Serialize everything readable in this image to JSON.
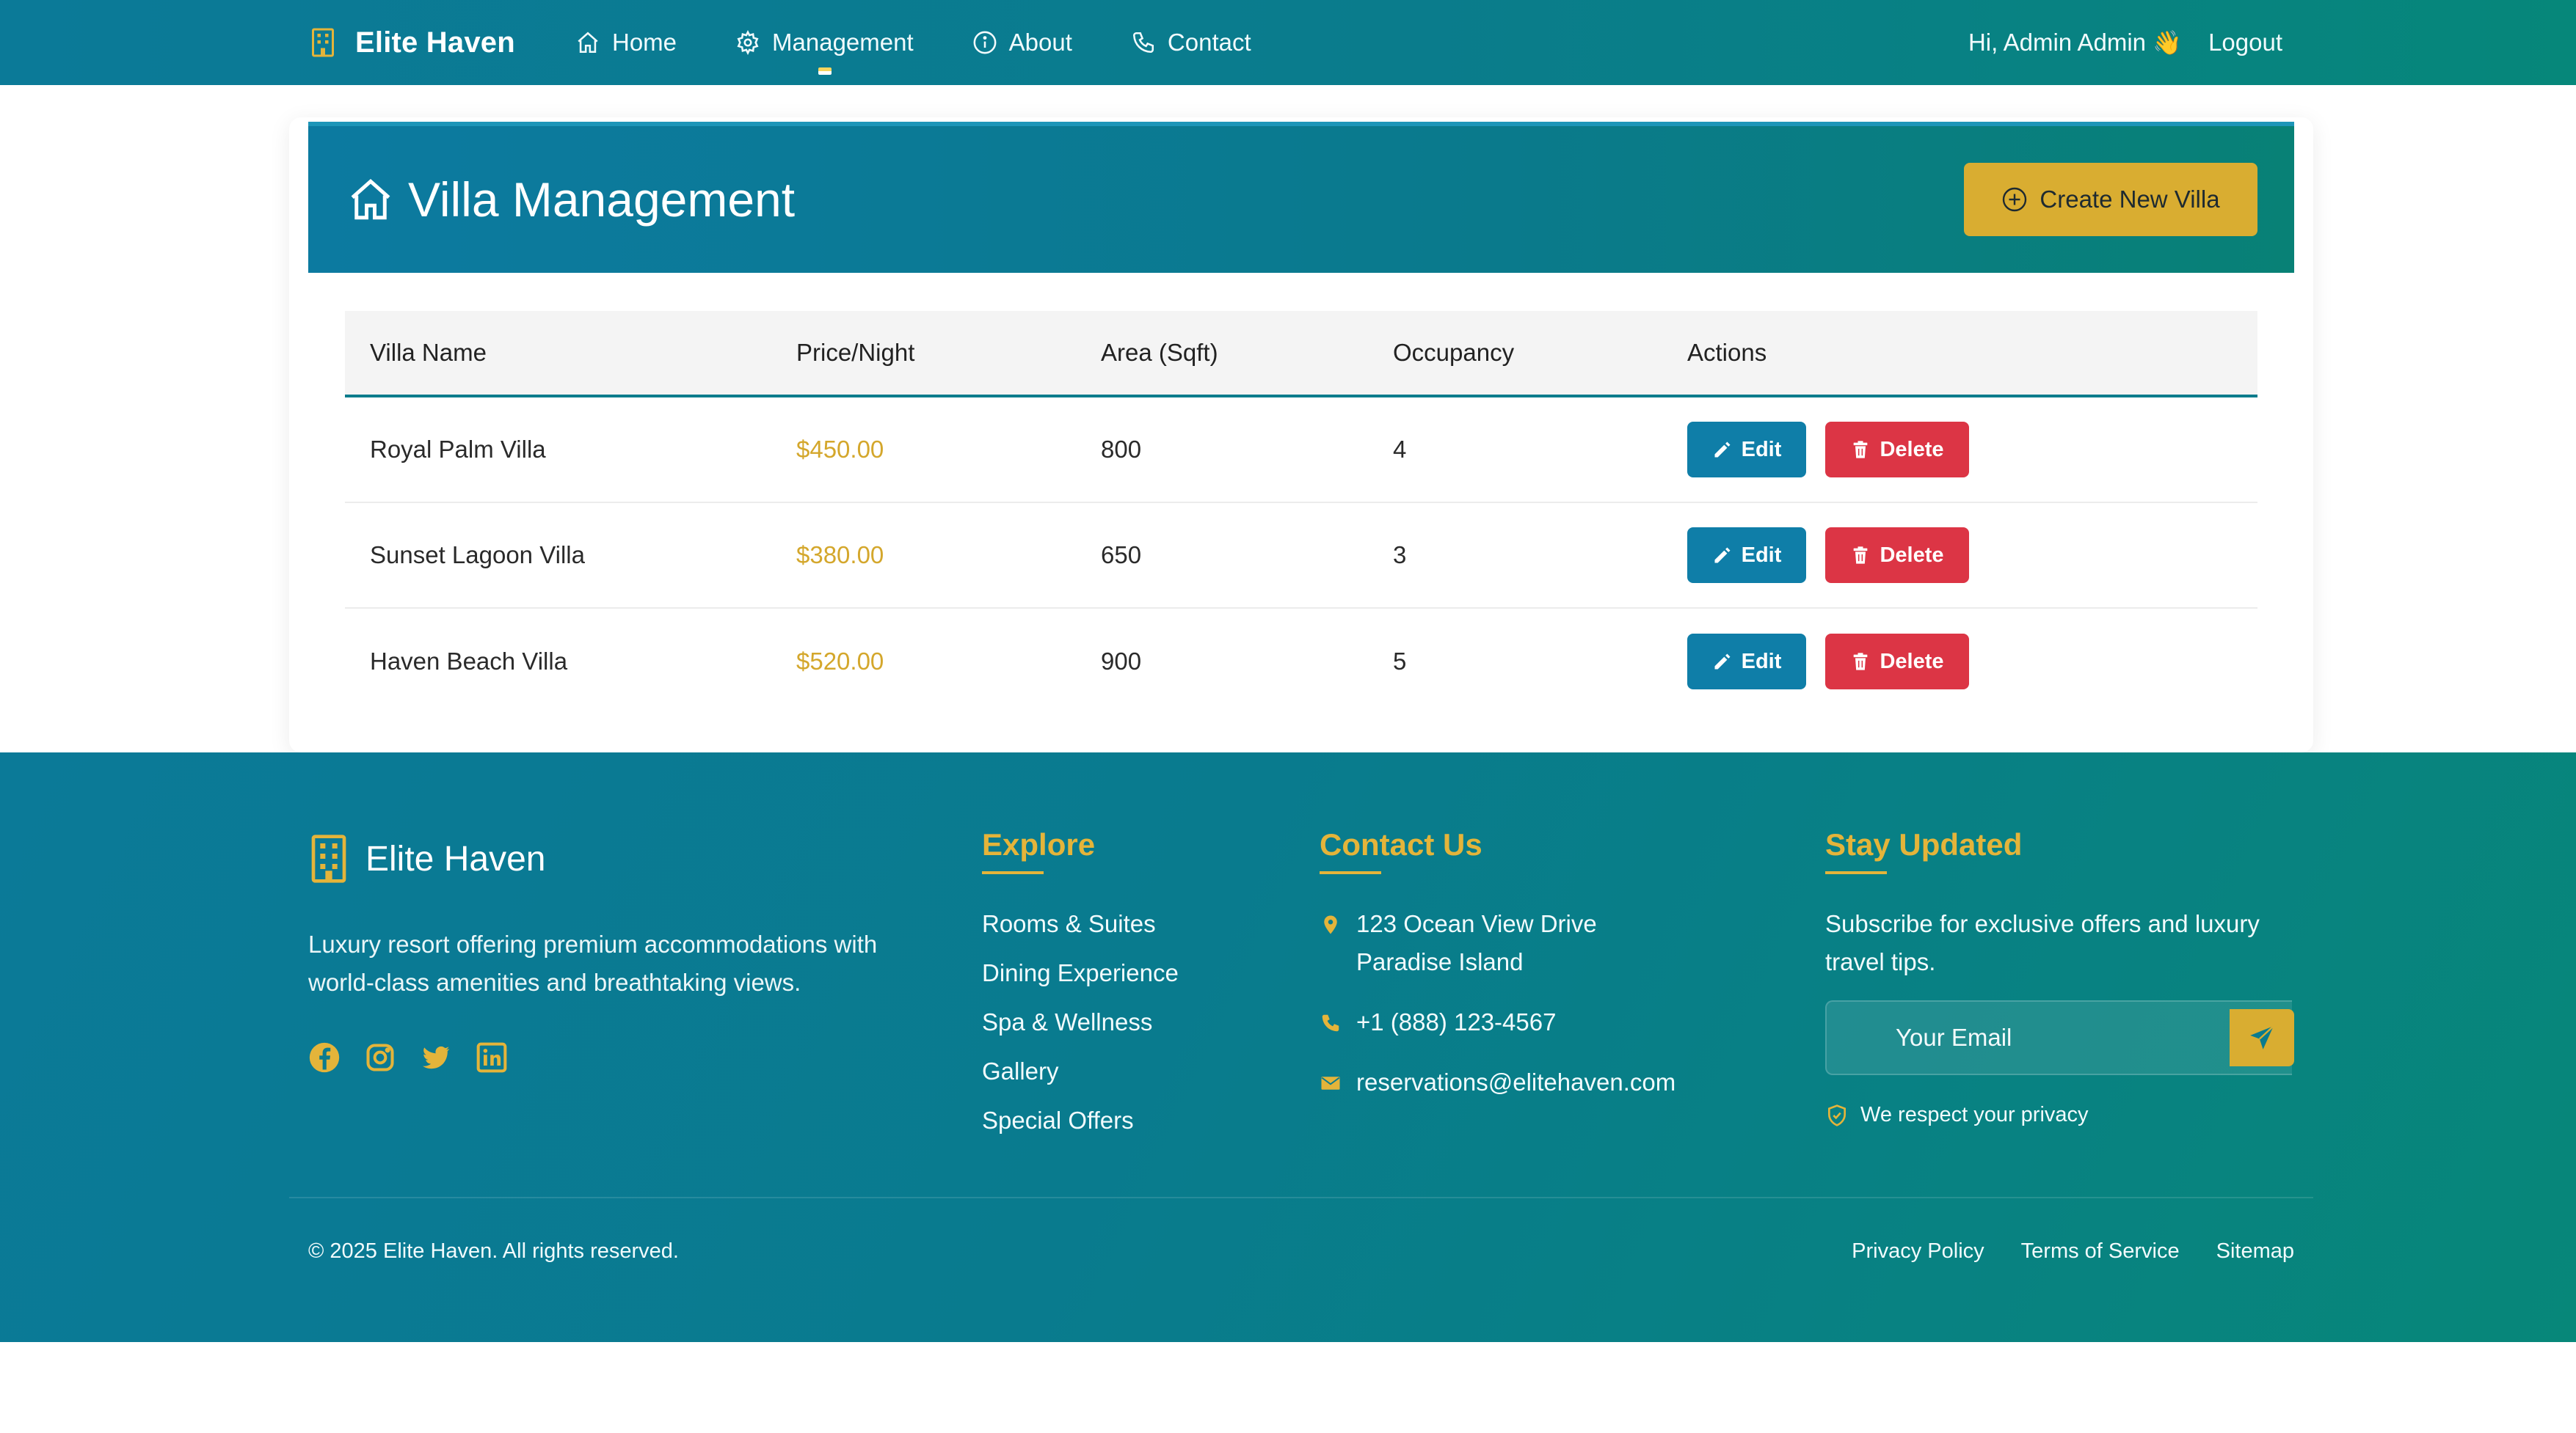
{
  "nav": {
    "brand": "Elite Haven",
    "links": [
      {
        "label": "Home",
        "icon": "home-icon"
      },
      {
        "label": "Management",
        "icon": "gear-icon"
      },
      {
        "label": "About",
        "icon": "info-icon"
      },
      {
        "label": "Contact",
        "icon": "phone-icon"
      }
    ],
    "greeting": "Hi, Admin Admin",
    "greeting_emoji": "👋",
    "logout": "Logout"
  },
  "page": {
    "title": "Villa Management",
    "create_button": "Create New Villa"
  },
  "table": {
    "headers": [
      "Villa Name",
      "Price/Night",
      "Area (Sqft)",
      "Occupancy",
      "Actions"
    ],
    "rows": [
      {
        "name": "Royal Palm Villa",
        "price": "$450.00",
        "area": "800",
        "occupancy": "4"
      },
      {
        "name": "Sunset Lagoon Villa",
        "price": "$380.00",
        "area": "650",
        "occupancy": "3"
      },
      {
        "name": "Haven Beach Villa",
        "price": "$520.00",
        "area": "900",
        "occupancy": "5"
      }
    ],
    "edit_label": "Edit",
    "delete_label": "Delete"
  },
  "footer": {
    "brand": "Elite Haven",
    "description": "Luxury resort offering premium accommodations with world-class amenities and breathtaking views.",
    "explore_title": "Explore",
    "explore_links": [
      "Rooms & Suites",
      "Dining Experience",
      "Spa & Wellness",
      "Gallery",
      "Special Offers"
    ],
    "contact_title": "Contact Us",
    "address_line1": "123 Ocean View Drive",
    "address_line2": "Paradise Island",
    "phone": "+1 (888) 123-4567",
    "email": "reservations@elitehaven.com",
    "subscribe_title": "Stay Updated",
    "subscribe_text": "Subscribe for exclusive offers and luxury travel tips.",
    "email_placeholder": "Your Email",
    "privacy_note": "We respect your privacy",
    "copyright": "© 2025 Elite Haven. All rights reserved.",
    "legal_links": [
      "Privacy Policy",
      "Terms of Service",
      "Sitemap"
    ]
  },
  "colors": {
    "primary": "#0b7a98",
    "teal": "#078779",
    "gold": "#d9ad31",
    "danger": "#dc3545",
    "edit": "#0f7ea8"
  }
}
